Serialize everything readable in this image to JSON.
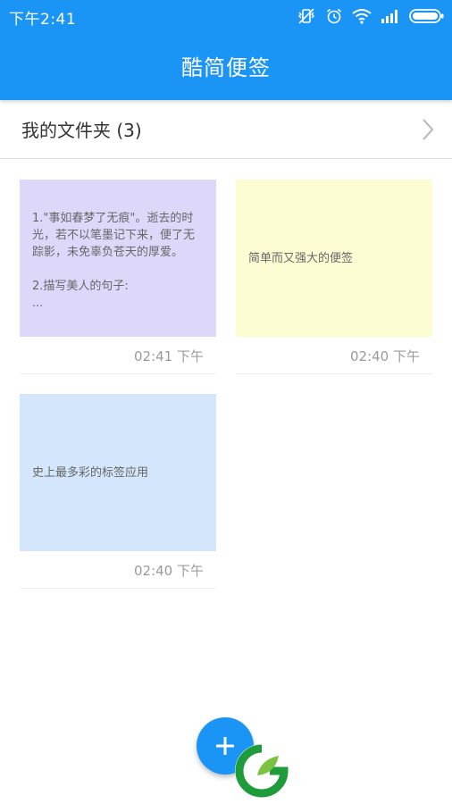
{
  "status_bar": {
    "time": "下午2:41",
    "icons": [
      "vibrate-off-icon",
      "alarm-icon",
      "wifi-icon",
      "signal-icon",
      "battery-icon"
    ]
  },
  "app": {
    "title": "酷简便签",
    "accent_color": "#1a94f5"
  },
  "folder": {
    "label": "我的文件夹 (3)",
    "chevron_icon": "chevron-right-icon"
  },
  "notes": [
    {
      "text": "1.\"事如春梦了无痕\"。逝去的时\n光，若不以笔墨记下来，便了无\n踪影，未免辜负苍天的厚爱。\n\n2.描写美人的句子:\n...",
      "time": "02:41 下午",
      "color": "#ddd8fa"
    },
    {
      "text": "简单而又强大的便签",
      "time": "02:40 下午",
      "color": "#fdfdd4"
    },
    {
      "text": "史上最多彩的标签应用",
      "time": "02:40 下午",
      "color": "#d3e6fb"
    }
  ],
  "fab": {
    "icon": "plus-icon"
  },
  "watermark": {
    "icon": "leaf-g-logo"
  }
}
